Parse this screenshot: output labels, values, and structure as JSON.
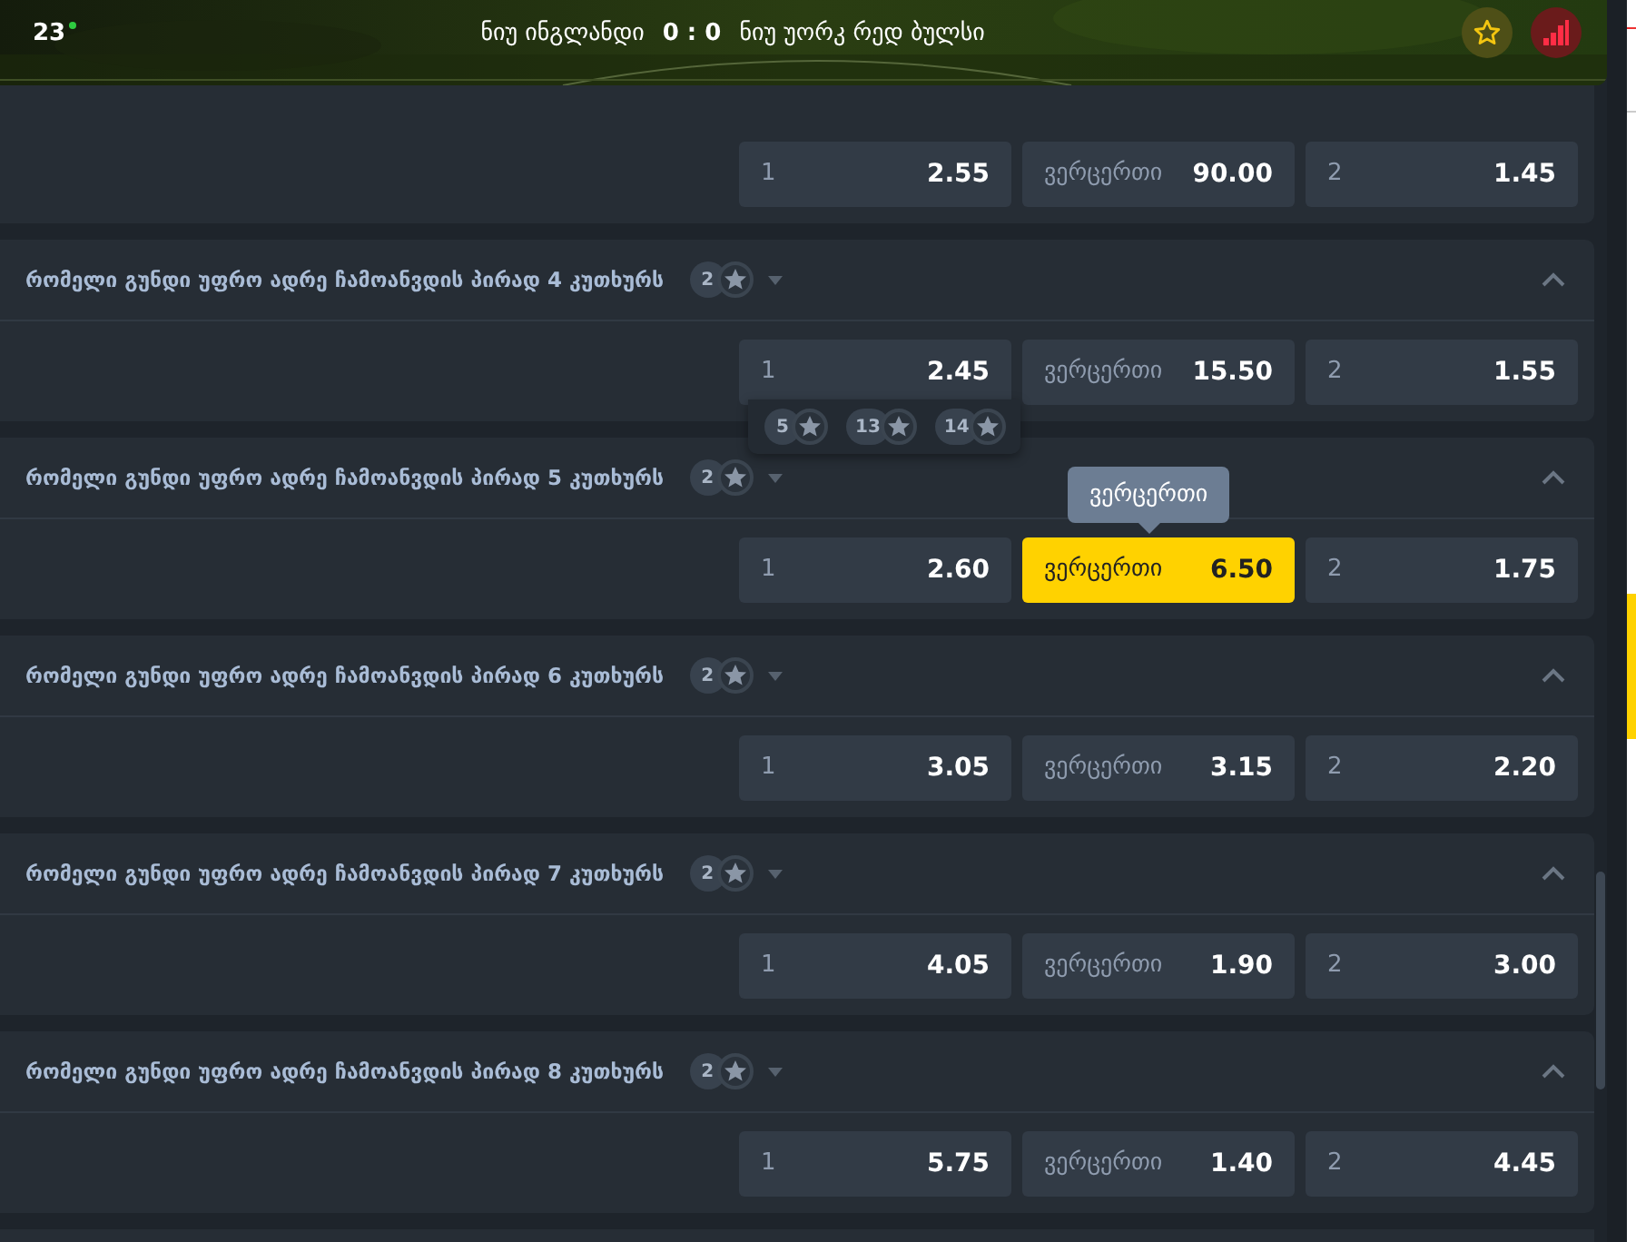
{
  "header": {
    "minute": "23",
    "home": "ნიუ ინგლანდი",
    "score": "0 : 0",
    "away": "ნიუ უორკ რედ ბულსი",
    "favorite": false
  },
  "markets": [
    {
      "odds": [
        {
          "label": "1",
          "value": "2.55",
          "selected": false
        },
        {
          "label": "ვერცერთი",
          "value": "90.00",
          "selected": false
        },
        {
          "label": "2",
          "value": "1.45",
          "selected": false
        }
      ]
    },
    {
      "title": "რომელი გუნდი უფრო ადრე ჩამოანვდის პირად 4 კუთხურს",
      "count": "2",
      "expanded": true,
      "odds": [
        {
          "label": "1",
          "value": "2.45",
          "selected": false
        },
        {
          "label": "ვერცერთი",
          "value": "15.50",
          "selected": false
        },
        {
          "label": "2",
          "value": "1.55",
          "selected": false
        }
      ]
    },
    {
      "title": "რომელი გუნდი უფრო ადრე ჩამოანვდის პირად 5 კუთხურს",
      "count": "2",
      "expanded": true,
      "odds": [
        {
          "label": "1",
          "value": "2.60",
          "selected": false
        },
        {
          "label": "ვერცერთი",
          "value": "6.50",
          "selected": true,
          "tooltip": "ვერცერთი"
        },
        {
          "label": "2",
          "value": "1.75",
          "selected": false
        }
      ]
    },
    {
      "title": "რომელი გუნდი უფრო ადრე ჩამოანვდის პირად 6 კუთხურს",
      "count": "2",
      "expanded": true,
      "odds": [
        {
          "label": "1",
          "value": "3.05",
          "selected": false
        },
        {
          "label": "ვერცერთი",
          "value": "3.15",
          "selected": false
        },
        {
          "label": "2",
          "value": "2.20",
          "selected": false
        }
      ]
    },
    {
      "title": "რომელი გუნდი უფრო ადრე ჩამოანვდის პირად 7 კუთხურს",
      "count": "2",
      "expanded": true,
      "odds": [
        {
          "label": "1",
          "value": "4.05",
          "selected": false
        },
        {
          "label": "ვერცერთი",
          "value": "1.90",
          "selected": false
        },
        {
          "label": "2",
          "value": "3.00",
          "selected": false
        }
      ]
    },
    {
      "title": "რომელი გუნდი უფრო ადრე ჩამოანვდის პირად 8 კუთხურს",
      "count": "2",
      "expanded": true,
      "odds": [
        {
          "label": "1",
          "value": "5.75",
          "selected": false
        },
        {
          "label": "ვერცერთი",
          "value": "1.40",
          "selected": false
        },
        {
          "label": "2",
          "value": "4.45",
          "selected": false
        }
      ]
    }
  ],
  "popup": {
    "badges": [
      "5",
      "13",
      "14"
    ]
  }
}
